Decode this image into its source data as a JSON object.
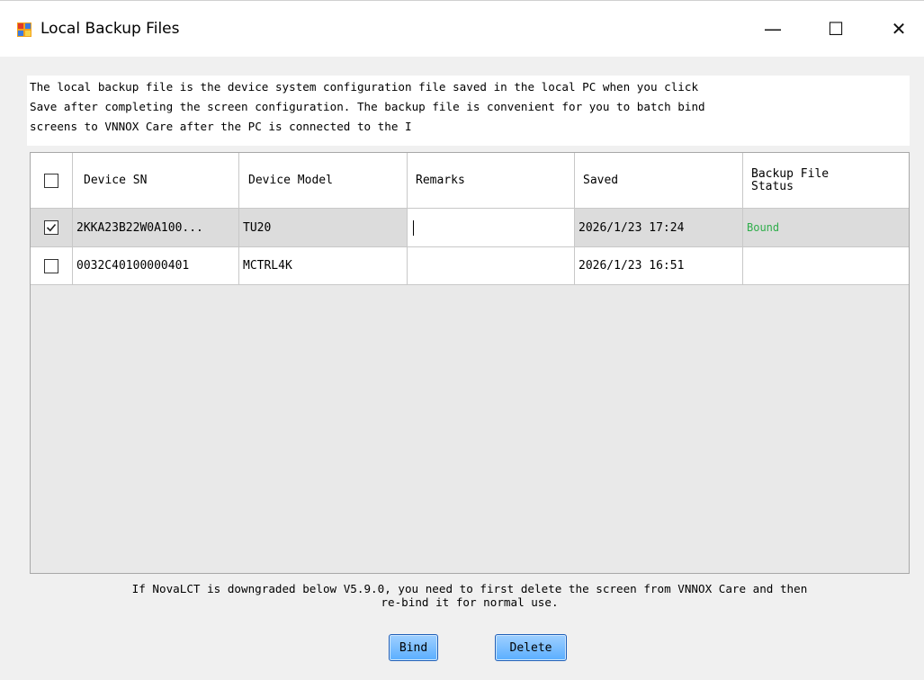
{
  "window": {
    "title": "Local Backup Files",
    "controls": {
      "minimize": "—",
      "maximize": "☐",
      "close": "✕"
    }
  },
  "description": {
    "lines": [
      "The local backup file is the device system configuration file saved in the local PC when you click",
      "Save after completing the screen configuration. The backup file is convenient for you to batch bind",
      "screens to VNNOX Care after the PC is connected to the I"
    ]
  },
  "table": {
    "headers": [
      "Device SN",
      "Device Model",
      "Remarks",
      "Saved",
      "Backup File Status"
    ],
    "header_status_lines": [
      "Backup File",
      "Status"
    ],
    "rows": [
      {
        "checked": true,
        "device_sn": "2KKA23B22W0A100...",
        "device_model": "TU20",
        "remarks": "",
        "saved": "2026/1/23 17:24",
        "status": "Bound"
      },
      {
        "checked": false,
        "device_sn": "0032C40100000401",
        "device_model": "MCTRL4K",
        "remarks": "",
        "saved": "2026/1/23 16:51",
        "status": ""
      }
    ]
  },
  "note": {
    "line1": "If NovaLCT is downgraded below V5.9.0, you need to first delete the screen from VNNOX Care and then",
    "line2": "re-bind it for normal use."
  },
  "buttons": {
    "bind": "Bind",
    "delete": "Delete"
  },
  "colors": {
    "status_bound": "#2fae4b",
    "button_blue": "#5aaeff",
    "selected_row": "#dcdcdc"
  }
}
